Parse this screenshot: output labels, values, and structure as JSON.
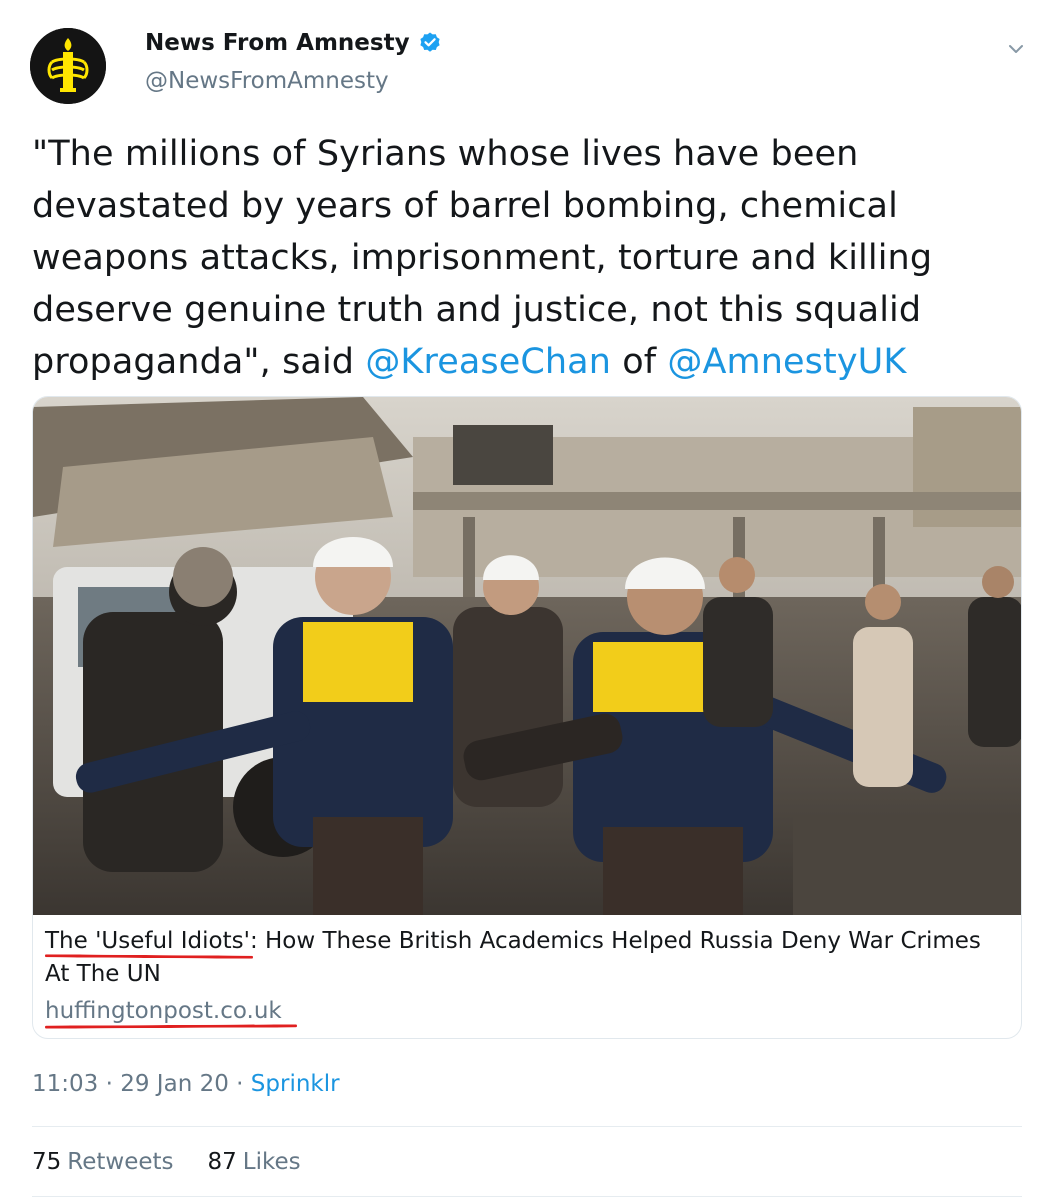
{
  "account": {
    "display_name": "News From Amnesty",
    "handle": "@NewsFromAmnesty",
    "avatar_icon": "amnesty-candle-logo",
    "verified_icon": "verified-badge-icon"
  },
  "tweet": {
    "line_1": "\"The millions of Syrians whose lives have been",
    "line_2": "devastated by years of barrel bombing, chemical",
    "line_3": "weapons attacks, imprisonment, torture and killing",
    "line_4": "deserve genuine truth and justice, not this squalid",
    "line_5_before": "propaganda\", said ",
    "mention_1": "@KreaseChan",
    "line_5_middle": " of ",
    "mention_2": "@AmnestyUK"
  },
  "card": {
    "title_part_1": "The 'Useful Idiots'",
    "title_part_2": ": How These British Academics Helped Russia Deny War Crimes",
    "title_line_2": "At The UN",
    "domain": "huffingtonpost.co.uk"
  },
  "meta": {
    "time": "11:03",
    "sep_1": " · ",
    "date": "29 Jan 20",
    "sep_2": " · ",
    "source": "Sprinklr"
  },
  "stats": {
    "retweets_count": "75",
    "retweets_label": "Retweets",
    "likes_count": "87",
    "likes_label": "Likes"
  },
  "colors": {
    "link": "#1b95e0",
    "secondary_text": "#657786",
    "annotation_underline": "#e02020",
    "avatar_bg": "#141414",
    "logo_yellow": "#ffe600"
  }
}
